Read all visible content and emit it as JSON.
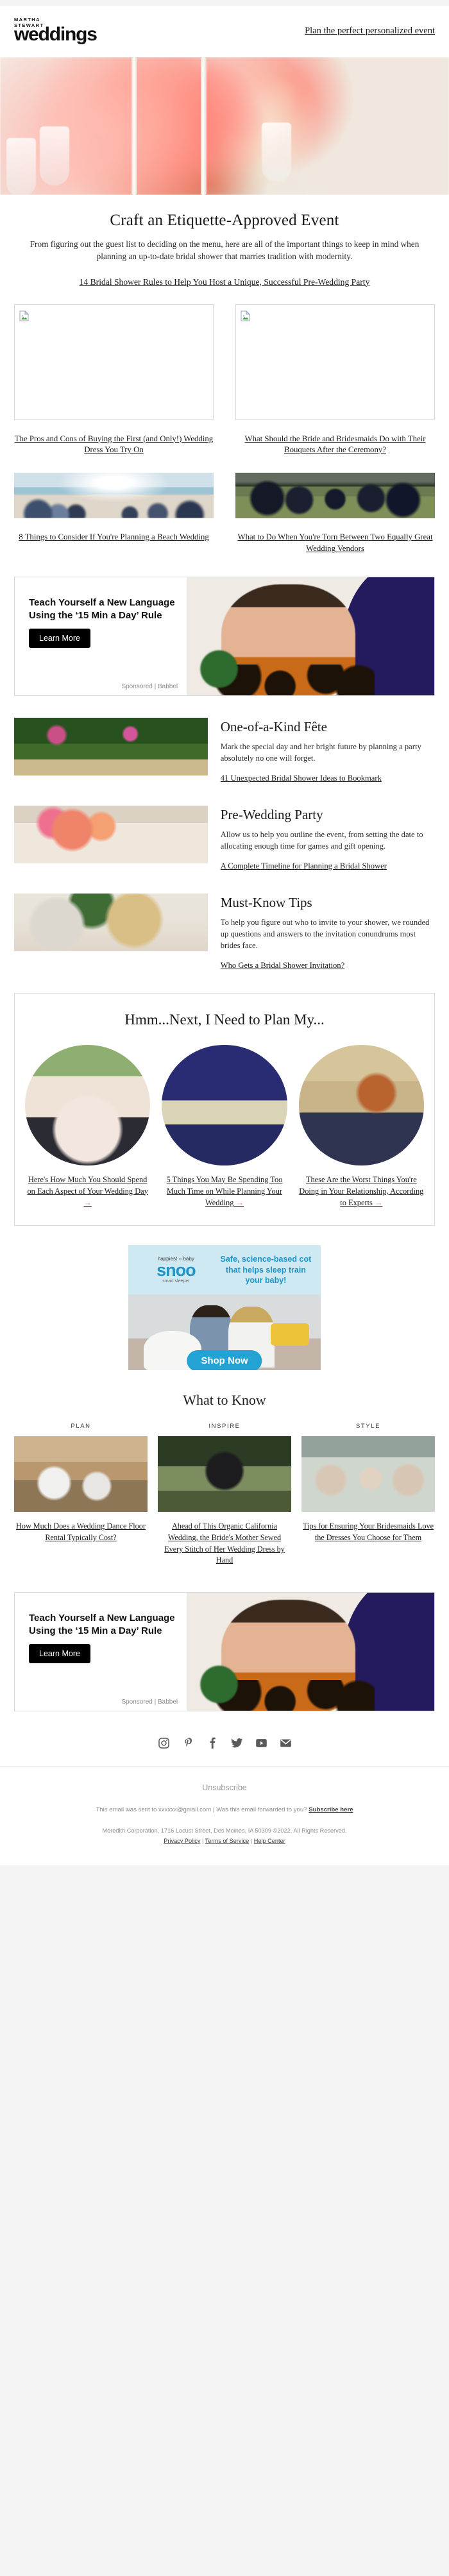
{
  "header": {
    "logo_kicker1": "MARTHA",
    "logo_kicker2": "STEWART",
    "logo_word": "weddings",
    "link": "Plan the perfect personalized event"
  },
  "intro": {
    "title": "Craft an Etiquette-Approved Event",
    "body": "From figuring out the guest list to deciding on the menu, here are all of the important things to keep in mind when planning an up-to-date bridal shower that marries tradition with modernity.",
    "lead_link": "14 Bridal Shower Rules to Help You Host a Unique, Successful Pre-Wedding Party"
  },
  "grid_top": [
    {
      "link": "The Pros and Cons of Buying the First (and Only!) Wedding Dress You Try On"
    },
    {
      "link": "What Should the Bride and Bridesmaids Do with Their Bouquets After the Ceremony?"
    }
  ],
  "grid_bottom": [
    {
      "link": "8 Things to Consider If You're Planning a Beach Wedding"
    },
    {
      "link": "What to Do When You're Torn Between Two Equally Great Wedding Vendors"
    }
  ],
  "babbel": {
    "headline": "Teach Yourself a New Language Using the ‘15 Min a Day’ Rule",
    "button": "Learn More",
    "sponsor": "Sponsored | Babbel"
  },
  "features": [
    {
      "title": "One-of-a-Kind Fête",
      "body": "Mark the special day and her bright future by planning a party absolutely no one will forget.",
      "link": "41 Unexpected Bridal Shower Ideas to Bookmark"
    },
    {
      "title": "Pre-Wedding Party",
      "body": "Allow us to help you outline the event, from setting the date to allocating enough time for games and gift opening.",
      "link": "A Complete Timeline for Planning a Bridal Shower"
    },
    {
      "title": "Must-Know Tips",
      "body": "To help you figure out who to invite to your shower, we rounded up questions and answers to the invitation conundrums most brides face.",
      "link": "Who Gets a Bridal Shower Invitation?"
    }
  ],
  "hmm": {
    "title": "Hmm...Next, I Need to Plan My...",
    "arrow": "→",
    "items": [
      {
        "link": "Here's How Much You Should Spend on Each Aspect of Your Wedding Day"
      },
      {
        "link": "5 Things You May Be Spending Too Much Time on While Planning Your Wedding"
      },
      {
        "link": "These Are the Worst Things You're Doing in Your Relationship, According to Experts"
      }
    ]
  },
  "snoo": {
    "brand_top": "happiest ○ baby",
    "brand_big": "snoo",
    "brand_sub": "smart sleeper",
    "copy": "Safe, science-based cot that helps sleep train your baby!",
    "button": "Shop Now"
  },
  "what_to_know": {
    "title": "What to Know",
    "columns": [
      {
        "kicker": "PLAN",
        "link": "How Much Does a Wedding Dance Floor Rental Typically Cost?"
      },
      {
        "kicker": "INSPIRE",
        "link": "Ahead of This Organic California Wedding, the Bride's Mother Sewed Every Stitch of Her Wedding Dress by Hand"
      },
      {
        "kicker": "STYLE",
        "link": "Tips for Ensuring Your Bridesmaids Love the Dresses You Choose for Them"
      }
    ]
  },
  "babbel2": {
    "headline": "Teach Yourself a New Language Using the ‘15 Min a Day’ Rule",
    "button": "Learn More",
    "sponsor": "Sponsored | Babbel"
  },
  "footer": {
    "social": [
      "instagram-icon",
      "pinterest-icon",
      "facebook-icon",
      "twitter-icon",
      "youtube-icon",
      "email-icon"
    ],
    "unsubscribe": "Unsubscribe",
    "sent_to": "This email was sent to xxxxxx@gmail.com  |  Was this email forwarded to you?",
    "subscribe_link": "Subscribe here",
    "copyright": "Meredith Corporation, 1716 Locust Street, Des Moines, IA 50309 ©2022. All Rights Reserved.",
    "links": [
      "Privacy Policy",
      "Terms of Service",
      "Help Center"
    ],
    "separator": "|"
  }
}
